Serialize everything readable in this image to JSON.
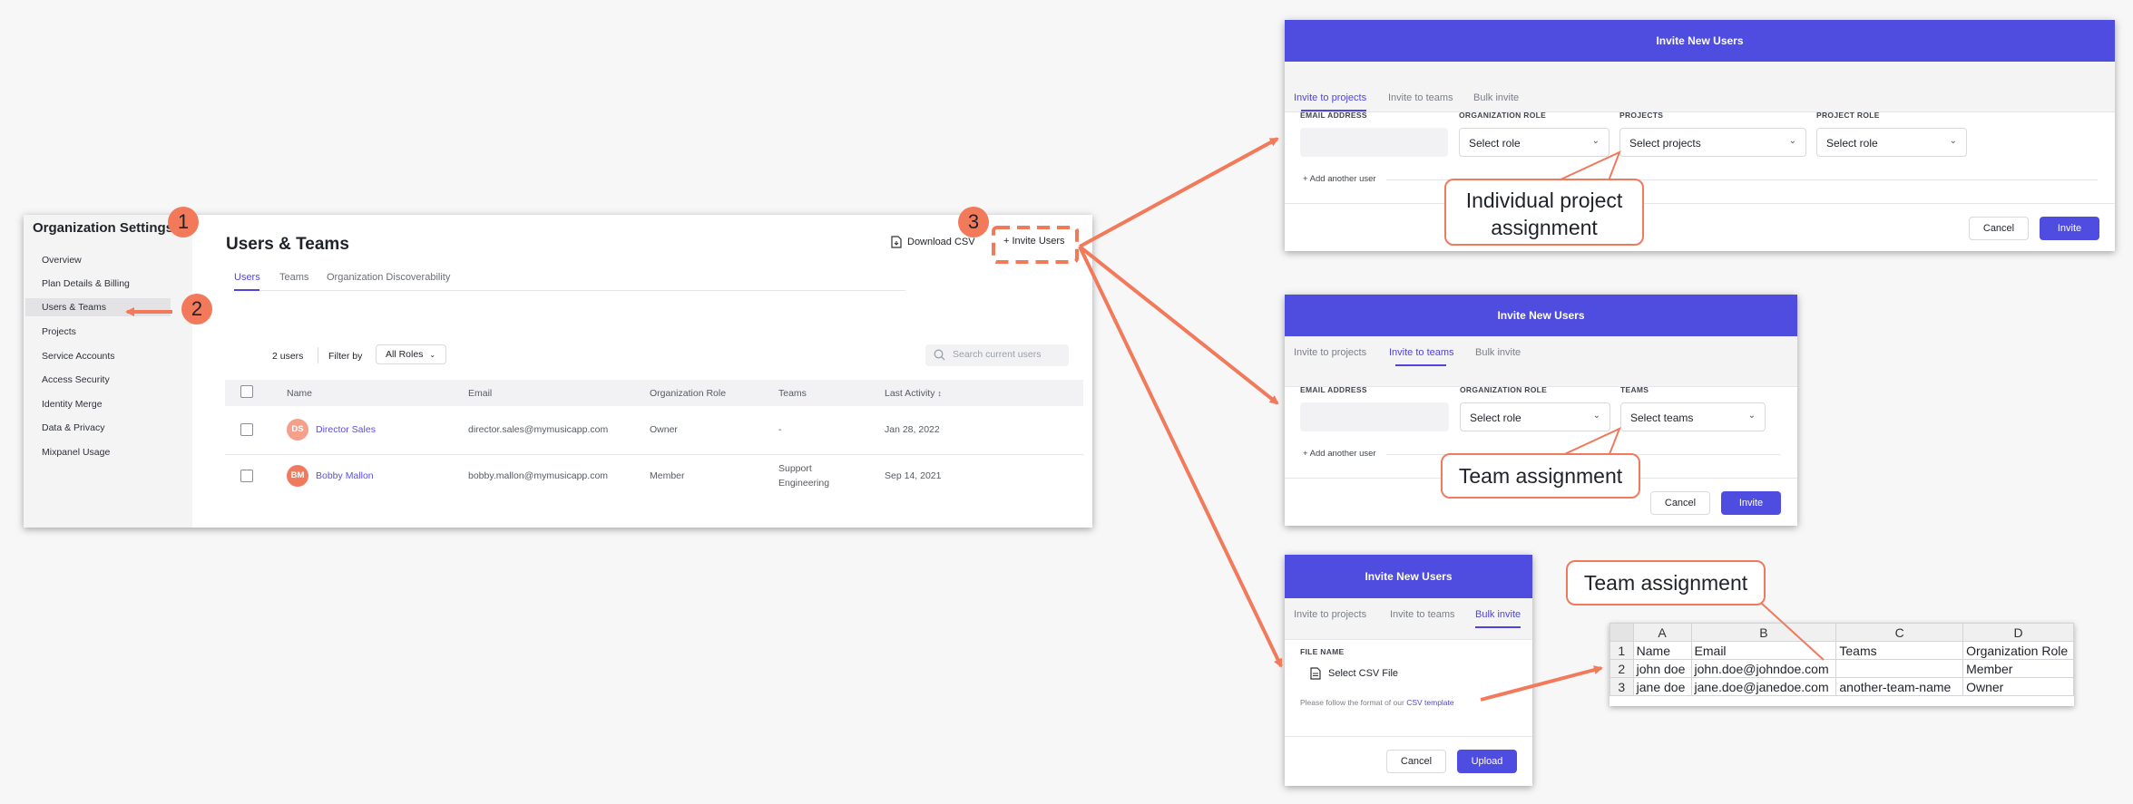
{
  "settings": {
    "sidebar": {
      "title": "Organization Settings",
      "items": [
        "Overview",
        "Plan Details & Billing",
        "Users & Teams",
        "Projects",
        "Service Accounts",
        "Access Security",
        "Identity Merge",
        "Data & Privacy",
        "Mixpanel Usage"
      ]
    },
    "page_title": "Users & Teams",
    "download_csv": "Download CSV",
    "invite_users": "+ Invite Users",
    "tabs": [
      "Users",
      "Teams",
      "Organization Discoverability"
    ],
    "users_count": "2 users",
    "filter_by": "Filter by",
    "roles_filter": "All Roles",
    "search_placeholder": "Search current users",
    "columns": [
      "Name",
      "Email",
      "Organization Role",
      "Teams",
      "Last Activity"
    ],
    "sort_icon": "↕",
    "rows": [
      {
        "initials": "DS",
        "avatar_color": "#f4a08b",
        "name": "Director Sales",
        "email": "director.sales@mymusicapp.com",
        "role": "Owner",
        "teams": "-",
        "teams2": "",
        "last_activity": "Jan 28, 2022"
      },
      {
        "initials": "BM",
        "avatar_color": "#ef7a5d",
        "name": "Bobby Mallon",
        "email": "bobby.mallon@mymusicapp.com",
        "role": "Member",
        "teams": "Support",
        "teams2": "Engineering",
        "last_activity": "Sep 14, 2021"
      }
    ]
  },
  "modal_projects": {
    "title": "Invite New Users",
    "tabs": [
      "Invite to projects",
      "Invite to teams",
      "Bulk invite"
    ],
    "labels": [
      "EMAIL ADDRESS",
      "ORGANIZATION ROLE",
      "PROJECTS",
      "PROJECT ROLE"
    ],
    "selects": [
      "Select role",
      "Select projects",
      "Select role"
    ],
    "add_user": "+ Add another user",
    "cancel": "Cancel",
    "submit": "Invite"
  },
  "modal_teams": {
    "title": "Invite New Users",
    "tabs": [
      "Invite to projects",
      "Invite to teams",
      "Bulk invite"
    ],
    "labels": [
      "EMAIL ADDRESS",
      "ORGANIZATION ROLE",
      "TEAMS"
    ],
    "selects": [
      "Select role",
      "Select teams"
    ],
    "add_user": "+ Add another user",
    "cancel": "Cancel",
    "submit": "Invite"
  },
  "modal_bulk": {
    "title": "Invite New Users",
    "tabs": [
      "Invite to projects",
      "Invite to teams",
      "Bulk invite"
    ],
    "file_label": "FILE NAME",
    "select_file": "Select CSV File",
    "hint": "Please follow the format of our",
    "hint_link": "CSV template",
    "cancel": "Cancel",
    "submit": "Upload"
  },
  "callouts": {
    "project_line1": "Individual project",
    "project_line2": "assignment",
    "team_modal": "Team assignment",
    "team_sheet": "Team assignment"
  },
  "badges": [
    "1",
    "2",
    "3"
  ],
  "spreadsheet": {
    "col_headers": [
      "A",
      "B",
      "C",
      "D"
    ],
    "rows": [
      [
        "1",
        "Name",
        "Email",
        "Teams",
        "Organization Role"
      ],
      [
        "2",
        "john doe",
        "john.doe@johndoe.com",
        "",
        "Member"
      ],
      [
        "3",
        "jane doe",
        "jane.doe@janedoe.com",
        "another-team-name",
        "Owner"
      ]
    ]
  },
  "colors": {
    "accent": "#4f4ce0",
    "annotation": "#f27a5b"
  }
}
